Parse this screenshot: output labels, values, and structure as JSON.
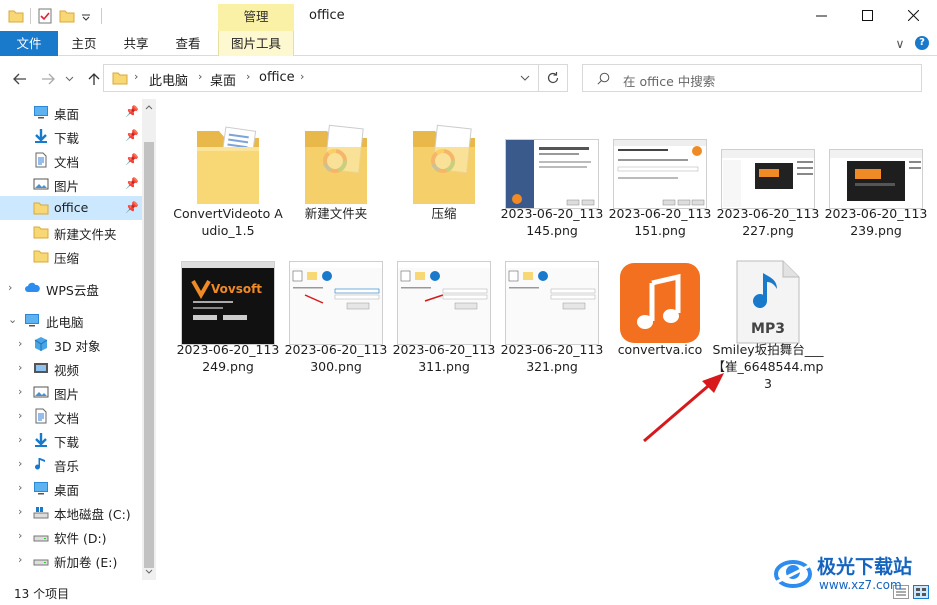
{
  "window": {
    "title": "office",
    "minimize": "—",
    "maximize": "☐",
    "close": "✕"
  },
  "ribbon": {
    "manage_label": "管理",
    "tabs": [
      "文件",
      "主页",
      "共享",
      "查看",
      "图片工具"
    ],
    "expand_glyph": "∨",
    "help_glyph": "?"
  },
  "address": {
    "crumbs": [
      "此电脑",
      "桌面",
      "office"
    ],
    "search_placeholder": "在 office 中搜索"
  },
  "sidebar": {
    "quick": [
      {
        "label": "桌面",
        "pinned": true
      },
      {
        "label": "下载",
        "pinned": true
      },
      {
        "label": "文档",
        "pinned": true
      },
      {
        "label": "图片",
        "pinned": true
      },
      {
        "label": "office",
        "pinned": true
      },
      {
        "label": "新建文件夹",
        "pinned": false
      },
      {
        "label": "压缩",
        "pinned": false
      }
    ],
    "wps": "WPS云盘",
    "pc": "此电脑",
    "pc_children": [
      "3D 对象",
      "视频",
      "图片",
      "文档",
      "下载",
      "音乐",
      "桌面",
      "本地磁盘 (C:)",
      "软件 (D:)",
      "新加卷 (E:)"
    ]
  },
  "files": [
    {
      "name": "ConvertVideoto Audio_1.5",
      "kind": "folder-docs"
    },
    {
      "name": "新建文件夹",
      "kind": "folder-color"
    },
    {
      "name": "压缩",
      "kind": "folder-color"
    },
    {
      "name": "2023-06-20_113 145.png",
      "kind": "shot-wizard"
    },
    {
      "name": "2023-06-20_113 151.png",
      "kind": "shot-dialog"
    },
    {
      "name": "2023-06-20_113 227.png",
      "kind": "shot-window"
    },
    {
      "name": "2023-06-20_113 239.png",
      "kind": "shot-dark"
    },
    {
      "name": "2023-06-20_113 249.png",
      "kind": "shot-vovsoft"
    },
    {
      "name": "2023-06-20_113 300.png",
      "kind": "shot-app"
    },
    {
      "name": "2023-06-20_113 311.png",
      "kind": "shot-app"
    },
    {
      "name": "2023-06-20_113 321.png",
      "kind": "shot-app"
    },
    {
      "name": "convertva.ico",
      "kind": "music-icon"
    },
    {
      "name": "Smiley坂拍舞台___【崔_6648544.mp3",
      "kind": "mp3"
    }
  ],
  "thumb_text": {
    "vovsoft": "Vovsoft",
    "mp3": "MP3"
  },
  "status": {
    "count": "13 个项目"
  },
  "watermark": {
    "brand": "极光下载站",
    "url": "www.xz7.com"
  },
  "colors": {
    "file_tab": "#1979ca",
    "selected": "#cce8ff",
    "manage": "#fbf1a6",
    "folder": "#f8d775",
    "arrow": "#d7191c",
    "music_bg": "#f37021"
  }
}
